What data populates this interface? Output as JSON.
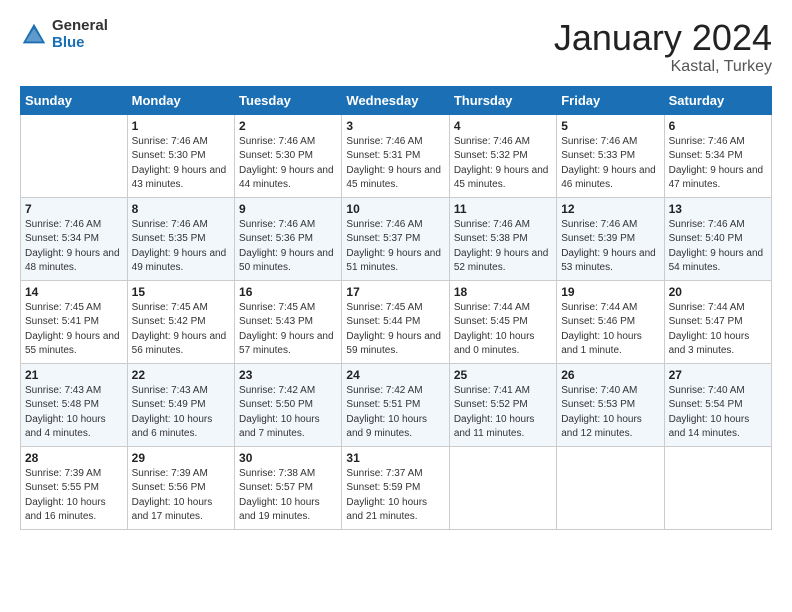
{
  "logo": {
    "general": "General",
    "blue": "Blue"
  },
  "title": "January 2024",
  "location": "Kastal, Turkey",
  "days_header": [
    "Sunday",
    "Monday",
    "Tuesday",
    "Wednesday",
    "Thursday",
    "Friday",
    "Saturday"
  ],
  "weeks": [
    [
      {
        "day": "",
        "sunrise": "",
        "sunset": "",
        "daylight": ""
      },
      {
        "day": "1",
        "sunrise": "Sunrise: 7:46 AM",
        "sunset": "Sunset: 5:30 PM",
        "daylight": "Daylight: 9 hours and 43 minutes."
      },
      {
        "day": "2",
        "sunrise": "Sunrise: 7:46 AM",
        "sunset": "Sunset: 5:30 PM",
        "daylight": "Daylight: 9 hours and 44 minutes."
      },
      {
        "day": "3",
        "sunrise": "Sunrise: 7:46 AM",
        "sunset": "Sunset: 5:31 PM",
        "daylight": "Daylight: 9 hours and 45 minutes."
      },
      {
        "day": "4",
        "sunrise": "Sunrise: 7:46 AM",
        "sunset": "Sunset: 5:32 PM",
        "daylight": "Daylight: 9 hours and 45 minutes."
      },
      {
        "day": "5",
        "sunrise": "Sunrise: 7:46 AM",
        "sunset": "Sunset: 5:33 PM",
        "daylight": "Daylight: 9 hours and 46 minutes."
      },
      {
        "day": "6",
        "sunrise": "Sunrise: 7:46 AM",
        "sunset": "Sunset: 5:34 PM",
        "daylight": "Daylight: 9 hours and 47 minutes."
      }
    ],
    [
      {
        "day": "7",
        "sunrise": "Sunrise: 7:46 AM",
        "sunset": "Sunset: 5:34 PM",
        "daylight": "Daylight: 9 hours and 48 minutes."
      },
      {
        "day": "8",
        "sunrise": "Sunrise: 7:46 AM",
        "sunset": "Sunset: 5:35 PM",
        "daylight": "Daylight: 9 hours and 49 minutes."
      },
      {
        "day": "9",
        "sunrise": "Sunrise: 7:46 AM",
        "sunset": "Sunset: 5:36 PM",
        "daylight": "Daylight: 9 hours and 50 minutes."
      },
      {
        "day": "10",
        "sunrise": "Sunrise: 7:46 AM",
        "sunset": "Sunset: 5:37 PM",
        "daylight": "Daylight: 9 hours and 51 minutes."
      },
      {
        "day": "11",
        "sunrise": "Sunrise: 7:46 AM",
        "sunset": "Sunset: 5:38 PM",
        "daylight": "Daylight: 9 hours and 52 minutes."
      },
      {
        "day": "12",
        "sunrise": "Sunrise: 7:46 AM",
        "sunset": "Sunset: 5:39 PM",
        "daylight": "Daylight: 9 hours and 53 minutes."
      },
      {
        "day": "13",
        "sunrise": "Sunrise: 7:46 AM",
        "sunset": "Sunset: 5:40 PM",
        "daylight": "Daylight: 9 hours and 54 minutes."
      }
    ],
    [
      {
        "day": "14",
        "sunrise": "Sunrise: 7:45 AM",
        "sunset": "Sunset: 5:41 PM",
        "daylight": "Daylight: 9 hours and 55 minutes."
      },
      {
        "day": "15",
        "sunrise": "Sunrise: 7:45 AM",
        "sunset": "Sunset: 5:42 PM",
        "daylight": "Daylight: 9 hours and 56 minutes."
      },
      {
        "day": "16",
        "sunrise": "Sunrise: 7:45 AM",
        "sunset": "Sunset: 5:43 PM",
        "daylight": "Daylight: 9 hours and 57 minutes."
      },
      {
        "day": "17",
        "sunrise": "Sunrise: 7:45 AM",
        "sunset": "Sunset: 5:44 PM",
        "daylight": "Daylight: 9 hours and 59 minutes."
      },
      {
        "day": "18",
        "sunrise": "Sunrise: 7:44 AM",
        "sunset": "Sunset: 5:45 PM",
        "daylight": "Daylight: 10 hours and 0 minutes."
      },
      {
        "day": "19",
        "sunrise": "Sunrise: 7:44 AM",
        "sunset": "Sunset: 5:46 PM",
        "daylight": "Daylight: 10 hours and 1 minute."
      },
      {
        "day": "20",
        "sunrise": "Sunrise: 7:44 AM",
        "sunset": "Sunset: 5:47 PM",
        "daylight": "Daylight: 10 hours and 3 minutes."
      }
    ],
    [
      {
        "day": "21",
        "sunrise": "Sunrise: 7:43 AM",
        "sunset": "Sunset: 5:48 PM",
        "daylight": "Daylight: 10 hours and 4 minutes."
      },
      {
        "day": "22",
        "sunrise": "Sunrise: 7:43 AM",
        "sunset": "Sunset: 5:49 PM",
        "daylight": "Daylight: 10 hours and 6 minutes."
      },
      {
        "day": "23",
        "sunrise": "Sunrise: 7:42 AM",
        "sunset": "Sunset: 5:50 PM",
        "daylight": "Daylight: 10 hours and 7 minutes."
      },
      {
        "day": "24",
        "sunrise": "Sunrise: 7:42 AM",
        "sunset": "Sunset: 5:51 PM",
        "daylight": "Daylight: 10 hours and 9 minutes."
      },
      {
        "day": "25",
        "sunrise": "Sunrise: 7:41 AM",
        "sunset": "Sunset: 5:52 PM",
        "daylight": "Daylight: 10 hours and 11 minutes."
      },
      {
        "day": "26",
        "sunrise": "Sunrise: 7:40 AM",
        "sunset": "Sunset: 5:53 PM",
        "daylight": "Daylight: 10 hours and 12 minutes."
      },
      {
        "day": "27",
        "sunrise": "Sunrise: 7:40 AM",
        "sunset": "Sunset: 5:54 PM",
        "daylight": "Daylight: 10 hours and 14 minutes."
      }
    ],
    [
      {
        "day": "28",
        "sunrise": "Sunrise: 7:39 AM",
        "sunset": "Sunset: 5:55 PM",
        "daylight": "Daylight: 10 hours and 16 minutes."
      },
      {
        "day": "29",
        "sunrise": "Sunrise: 7:39 AM",
        "sunset": "Sunset: 5:56 PM",
        "daylight": "Daylight: 10 hours and 17 minutes."
      },
      {
        "day": "30",
        "sunrise": "Sunrise: 7:38 AM",
        "sunset": "Sunset: 5:57 PM",
        "daylight": "Daylight: 10 hours and 19 minutes."
      },
      {
        "day": "31",
        "sunrise": "Sunrise: 7:37 AM",
        "sunset": "Sunset: 5:59 PM",
        "daylight": "Daylight: 10 hours and 21 minutes."
      },
      {
        "day": "",
        "sunrise": "",
        "sunset": "",
        "daylight": ""
      },
      {
        "day": "",
        "sunrise": "",
        "sunset": "",
        "daylight": ""
      },
      {
        "day": "",
        "sunrise": "",
        "sunset": "",
        "daylight": ""
      }
    ]
  ]
}
